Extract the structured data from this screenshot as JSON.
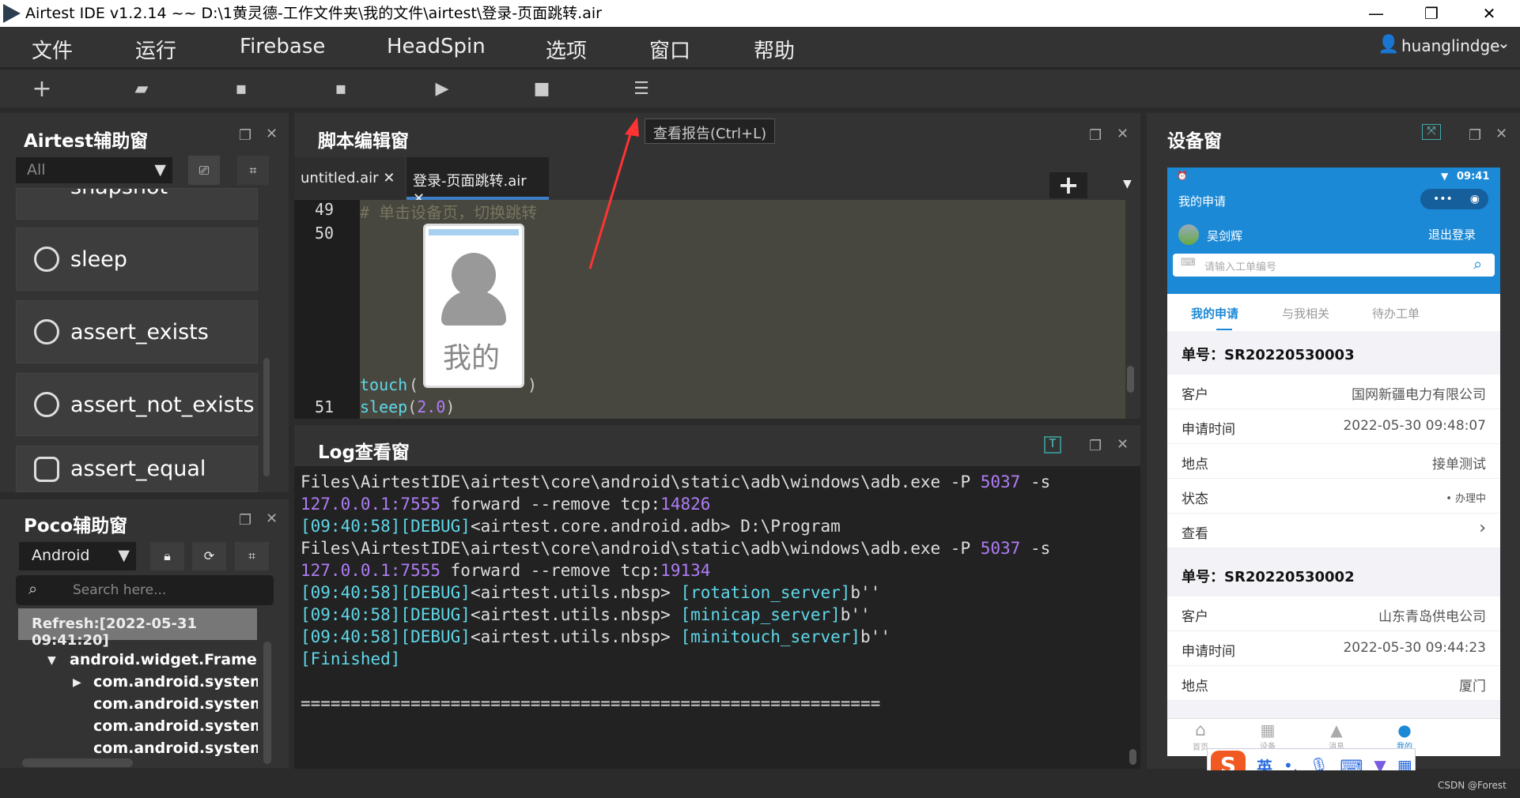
{
  "window": {
    "title": "Airtest IDE v1.2.14 ~~ D:\\1黄灵德-工作文件夹\\我的文件\\airtest\\登录-页面跳转.air",
    "minimize": "—",
    "maximize": "❐",
    "close": "✕"
  },
  "menu": [
    "文件",
    "运行",
    "Firebase",
    "HeadSpin",
    "选项",
    "窗口",
    "帮助"
  ],
  "user": {
    "name": "huanglindge"
  },
  "toolbar": {
    "tooltip": "查看报告(Ctrl+L)",
    "icons": [
      "plus-icon",
      "folder-icon",
      "save-icon",
      "save-as-icon",
      "play-icon",
      "stop-icon",
      "report-icon"
    ]
  },
  "airtest_panel": {
    "title": "Airtest辅助窗",
    "filter": "All",
    "partial_item": "snapshot",
    "actions": [
      "sleep",
      "assert_exists",
      "assert_not_exists",
      "assert_equal"
    ]
  },
  "poco_panel": {
    "title": "Poco辅助窗",
    "mode": "Android",
    "search_placeholder": "Search here...",
    "refresh": "Refresh:[2022-05-31 09:41:20]",
    "tree": [
      "android.widget.FrameLayout",
      "com.android.systemui:i",
      "com.android.systemui:i",
      "com.android.systemui:i",
      "com.android.systemui:i"
    ]
  },
  "editor": {
    "title": "脚本编辑窗",
    "tabs": [
      {
        "label": "untitled.air",
        "active": false
      },
      {
        "label": "登录-页面跳转.air",
        "active": true
      }
    ],
    "lines": {
      "n49": "49",
      "n50": "50",
      "n51": "51",
      "comment": "# 单击设备页，切换跳转",
      "touch": "touch",
      "sleep": "sleep",
      "sleep_arg": "2.0",
      "image_text": "我的"
    }
  },
  "log": {
    "title": "Log查看窗",
    "lines": [
      [
        [
          "Files\\AirtestIDE\\airtest\\core\\android\\static\\adb\\windows\\adb.exe -P ",
          ""
        ],
        [
          "5037",
          "pu"
        ],
        [
          " -s",
          ""
        ]
      ],
      [
        [
          "127.0.0.1:7555",
          "pu"
        ],
        [
          " forward --remove tcp:",
          ""
        ],
        [
          "14826",
          "pu"
        ]
      ],
      [
        [
          "[09:40:58][DEBUG]",
          "cy"
        ],
        [
          "<airtest.core.android.adb> D:\\Program",
          ""
        ]
      ],
      [
        [
          "Files\\AirtestIDE\\airtest\\core\\android\\static\\adb\\windows\\adb.exe -P ",
          ""
        ],
        [
          "5037",
          "pu"
        ],
        [
          " -s",
          ""
        ]
      ],
      [
        [
          "127.0.0.1:7555",
          "pu"
        ],
        [
          " forward --remove tcp:",
          ""
        ],
        [
          "19134",
          "pu"
        ]
      ],
      [
        [
          "[09:40:58][DEBUG]",
          "cy"
        ],
        [
          "<airtest.utils.nbsp> ",
          ""
        ],
        [
          "[rotation_server]",
          "cy"
        ],
        [
          "b''",
          ""
        ]
      ],
      [
        [
          "[09:40:58][DEBUG]",
          "cy"
        ],
        [
          "<airtest.utils.nbsp> ",
          ""
        ],
        [
          "[minicap_server]",
          "cy"
        ],
        [
          "b''",
          ""
        ]
      ],
      [
        [
          "[09:40:58][DEBUG]",
          "cy"
        ],
        [
          "<airtest.utils.nbsp> ",
          ""
        ],
        [
          "[minitouch_server]",
          "cy"
        ],
        [
          "b''",
          ""
        ]
      ],
      [
        [
          "[Finished]",
          "cy"
        ]
      ],
      [
        [
          "",
          ""
        ]
      ],
      [
        [
          "==========================================================",
          ""
        ]
      ]
    ]
  },
  "device": {
    "title": "设备窗",
    "phone": {
      "time": "09:41",
      "page_title": "我的申请",
      "user": "吴剑辉",
      "logout": "退出登录",
      "search_placeholder": "请输入工单编号",
      "tabs": [
        "我的申请",
        "与我相关",
        "待办工单"
      ],
      "orders": [
        {
          "no": "单号：SR20220530003",
          "rows": [
            [
              "客户",
              "国网新疆电力有限公司"
            ],
            [
              "申请时间",
              "2022-05-30 09:48:07"
            ],
            [
              "地点",
              "接单测试"
            ],
            [
              "状态",
              "• 办理中"
            ],
            [
              "查看",
              "›"
            ]
          ]
        },
        {
          "no": "单号：SR20220530002",
          "rows": [
            [
              "客户",
              "山东青岛供电公司"
            ],
            [
              "申请时间",
              "2022-05-30 09:44:23"
            ],
            [
              "地点",
              "厦门"
            ]
          ]
        }
      ],
      "nav": [
        "首页",
        "设备",
        "消息",
        "我的"
      ],
      "ime": [
        "英",
        "•,"
      ]
    },
    "accent": "#1c89d6"
  },
  "watermark": "CSDN @Forest"
}
